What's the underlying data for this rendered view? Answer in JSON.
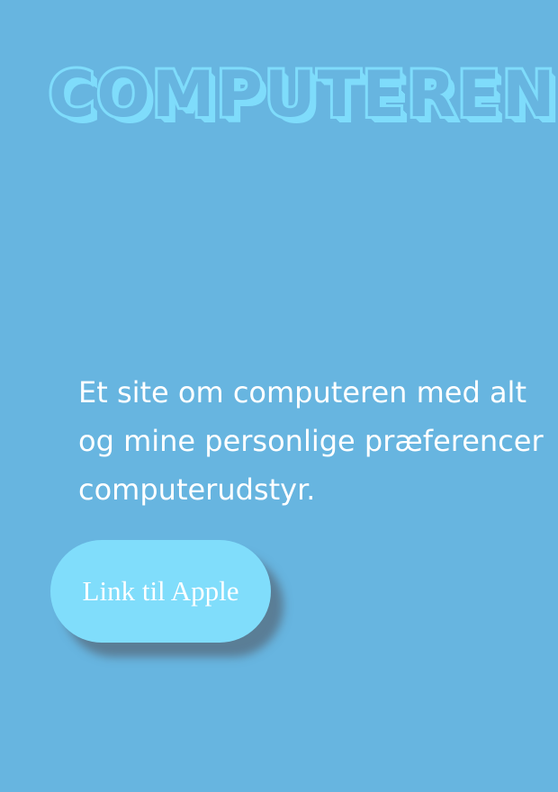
{
  "header": {
    "title": "COMPUTEREN"
  },
  "intro": {
    "text": "Et site om computeren med alt\nog mine personlige præferencer\ncomputerudstyr."
  },
  "cta": {
    "label": "Link til Apple"
  },
  "colors": {
    "background": "#67b5e0",
    "accent": "#7fdcfb",
    "text": "#ffffff"
  }
}
